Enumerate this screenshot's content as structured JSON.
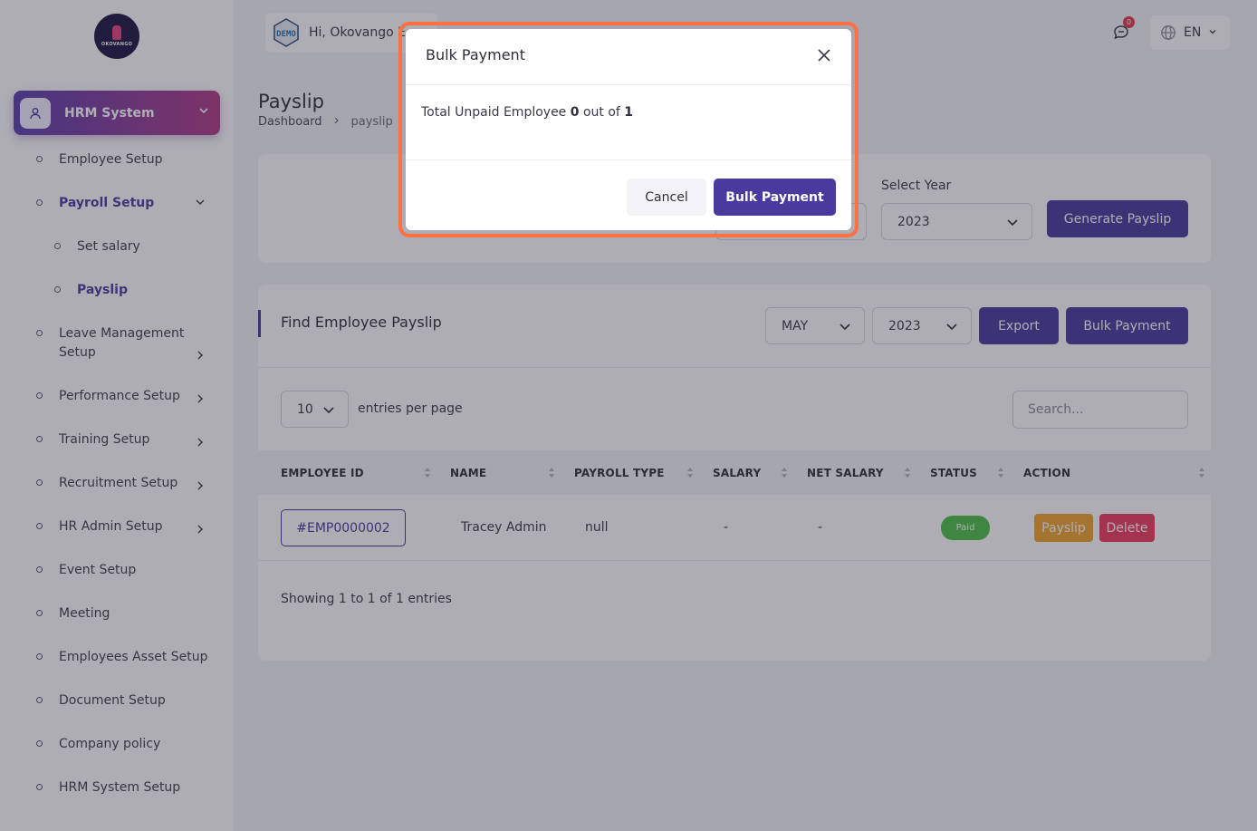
{
  "logo": {
    "text": "OKOVANGO"
  },
  "sidebar": {
    "header_label": "HRM System",
    "items": [
      {
        "label": "Employee Setup",
        "has_chevron": false
      },
      {
        "label": "Payroll Setup",
        "has_chevron": true,
        "expanded": true
      },
      {
        "label": "Set salary",
        "sub": true
      },
      {
        "label": "Payslip",
        "sub": true,
        "active": true
      },
      {
        "label": "Leave Management Setup",
        "has_chevron": true
      },
      {
        "label": "Performance Setup",
        "has_chevron": true
      },
      {
        "label": "Training Setup",
        "has_chevron": true
      },
      {
        "label": "Recruitment Setup",
        "has_chevron": true
      },
      {
        "label": "HR Admin Setup",
        "has_chevron": true
      },
      {
        "label": "Event Setup"
      },
      {
        "label": "Meeting"
      },
      {
        "label": "Employees Asset Setup"
      },
      {
        "label": "Document Setup"
      },
      {
        "label": "Company policy"
      },
      {
        "label": "HRM System Setup"
      }
    ]
  },
  "topbar": {
    "demo_icon_text": "DEMO",
    "greeting": "Hi, Okovango E",
    "message_count": "0",
    "language": "EN"
  },
  "page": {
    "title": "Payslip",
    "breadcrumb": [
      "Dashboard",
      "payslip"
    ]
  },
  "generate": {
    "year_label": "Select Year",
    "year_value": "2023",
    "button": "Generate Payslip"
  },
  "find": {
    "title": "Find Employee Payslip",
    "month_value": "MAY",
    "year_value": "2023",
    "export_button": "Export",
    "bulk_button": "Bulk Payment",
    "entries_value": "10",
    "entries_label": "entries per page",
    "search_placeholder": "Search...",
    "columns": [
      "EMPLOYEE ID",
      "NAME",
      "PAYROLL TYPE",
      "SALARY",
      "NET SALARY",
      "STATUS",
      "ACTION"
    ],
    "rows": [
      {
        "employee_id": "#EMP0000002",
        "name": "Tracey Admin",
        "payroll_type": "null",
        "salary": "-",
        "net_salary": "-",
        "status": "Paid",
        "actions": [
          "Payslip",
          "Delete"
        ]
      }
    ],
    "showing": "Showing 1 to 1 of 1 entries"
  },
  "modal": {
    "title": "Bulk Payment",
    "body_prefix": "Total Unpaid Employee",
    "unpaid": "0",
    "body_mid": "out of",
    "total": "1",
    "cancel": "Cancel",
    "confirm": "Bulk Payment"
  },
  "colors": {
    "primary": "#4a3a9e",
    "highlight": "#ff7043",
    "paid": "#4ec04b",
    "payslip_btn": "#f2a42d",
    "delete_btn": "#ef3b5c"
  }
}
